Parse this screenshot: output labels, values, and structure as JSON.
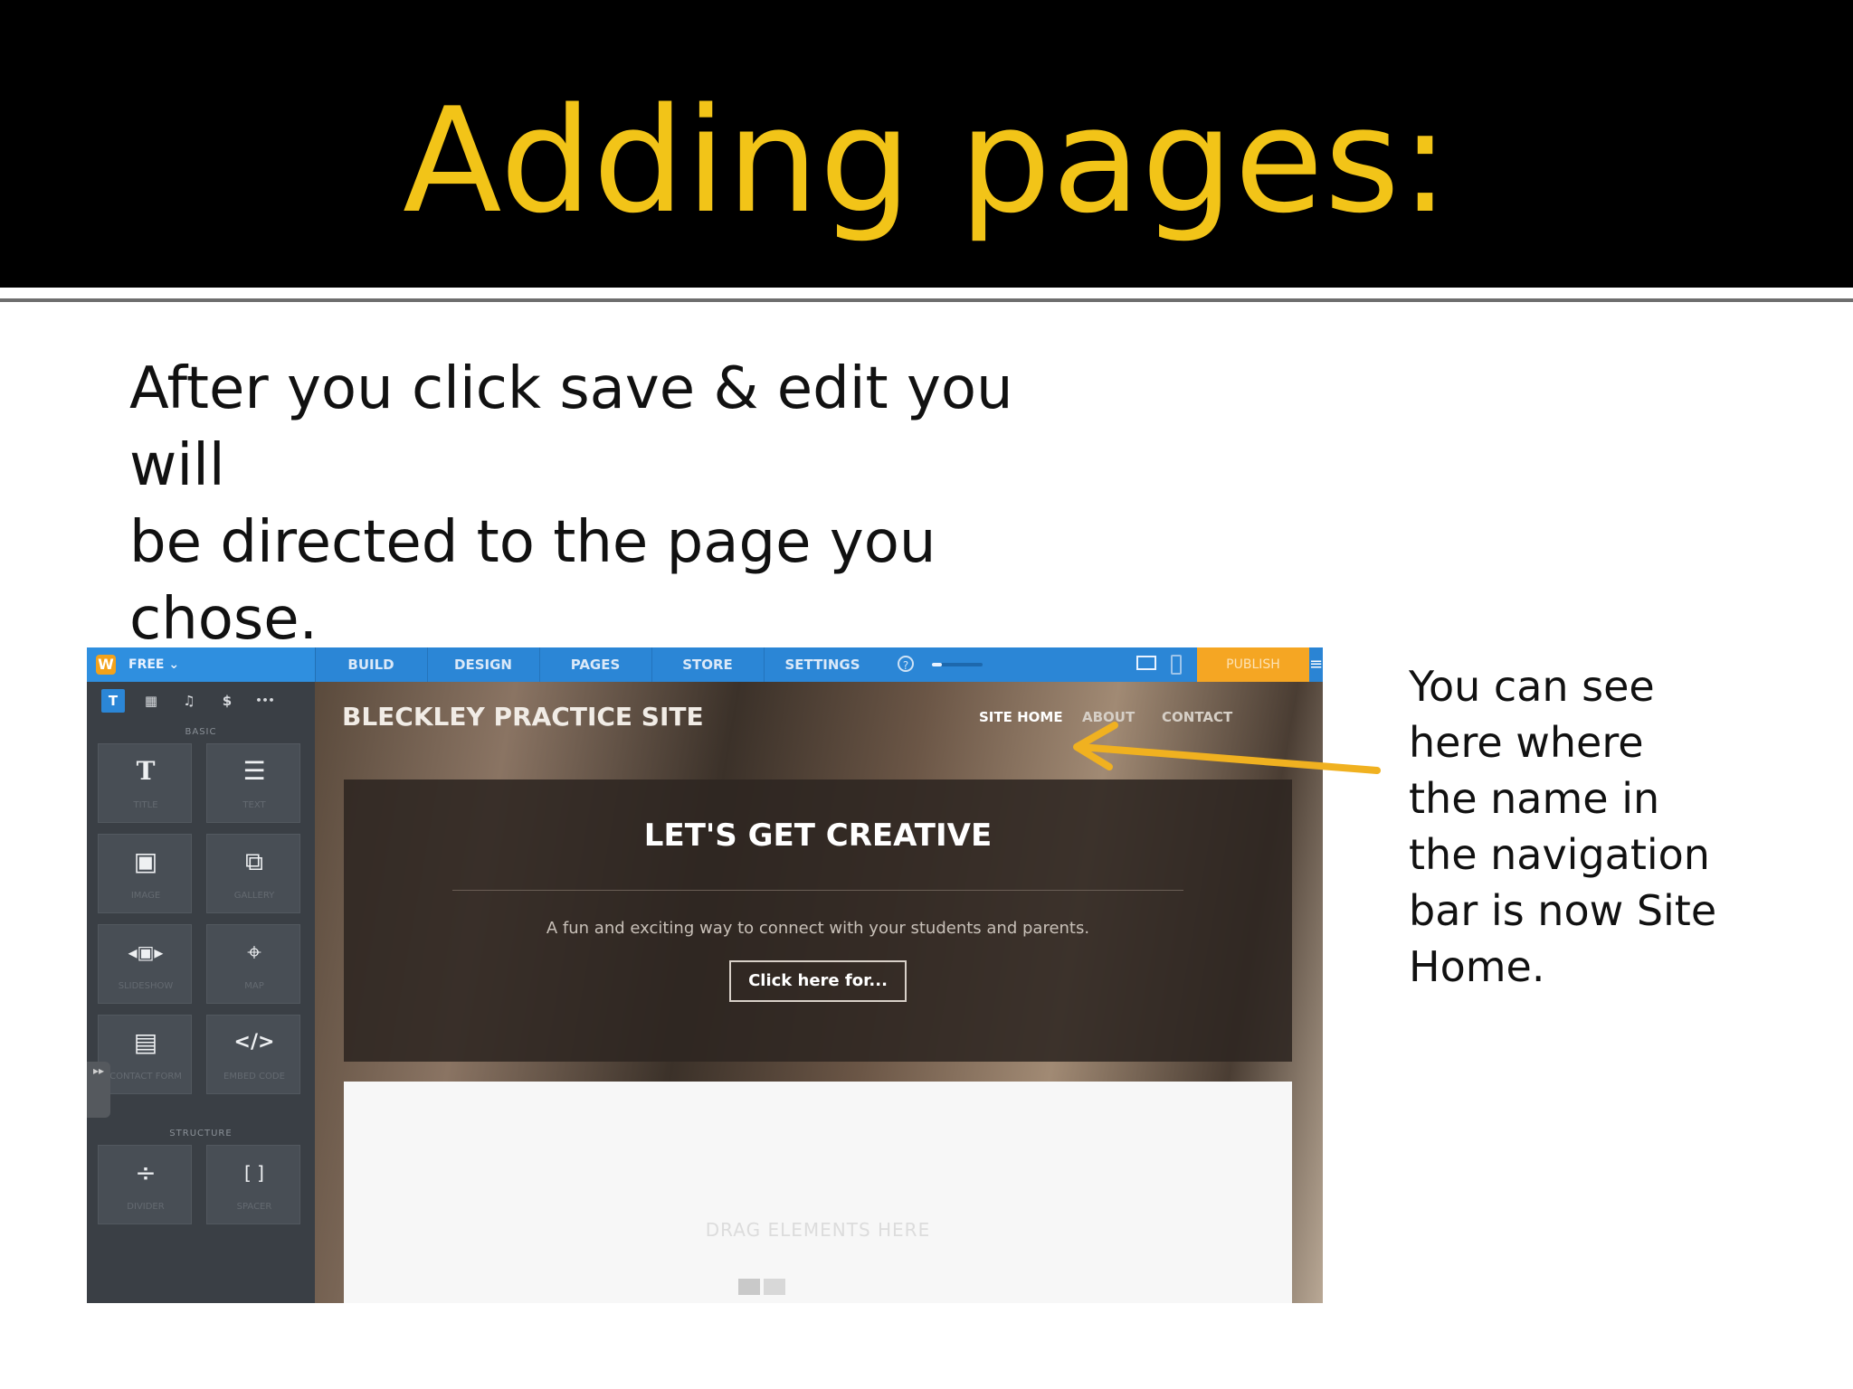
{
  "slide": {
    "title": "Adding pages:",
    "intro_line1": "After you click save & edit you will",
    "intro_line2": "be directed to the page you chose.",
    "callout": [
      "You can see",
      "here where",
      "the name in",
      "the navigation",
      "bar is now Site",
      "Home."
    ]
  },
  "editor": {
    "plan_label": "FREE",
    "logo_letter": "W",
    "tabs": [
      "BUILD",
      "DESIGN",
      "PAGES",
      "STORE",
      "SETTINGS"
    ],
    "help_icon": "?",
    "progress_fraction": 0.2,
    "publish_label": "PUBLISH",
    "menu_icon": "≡",
    "panel_tabs": [
      "T",
      "▦",
      "♫",
      "$",
      "•••"
    ],
    "section_basic": "BASIC",
    "section_structure": "STRUCTURE",
    "tiles": [
      {
        "icon": "T",
        "label": "TITLE"
      },
      {
        "icon": "☰",
        "label": "TEXT"
      },
      {
        "icon": "▣",
        "label": "IMAGE"
      },
      {
        "icon": "⧉",
        "label": "GALLERY"
      },
      {
        "icon": "◂▣▸",
        "label": "SLIDESHOW"
      },
      {
        "icon": "⌖",
        "label": "MAP"
      },
      {
        "icon": "▤",
        "label": "CONTACT FORM"
      },
      {
        "icon": "</>",
        "label": "EMBED CODE"
      },
      {
        "icon": "÷",
        "label": "DIVIDER"
      },
      {
        "icon": "[ ]",
        "label": "SPACER"
      }
    ],
    "handle_icon": "▸▸"
  },
  "site": {
    "title": "BLECKLEY PRACTICE SITE",
    "nav": [
      "SITE HOME",
      "ABOUT",
      "CONTACT"
    ],
    "hero_title": "LET'S GET CREATIVE",
    "hero_subtitle": "A fun and exciting way to connect with your students and parents.",
    "hero_button": "Click here for...",
    "drag_text": "DRAG ELEMENTS HERE"
  },
  "colors": {
    "title_yellow": "#f2c418",
    "arrow": "#f0b120",
    "topbar_blue": "#2b86d6",
    "publish_orange": "#f5a623"
  }
}
